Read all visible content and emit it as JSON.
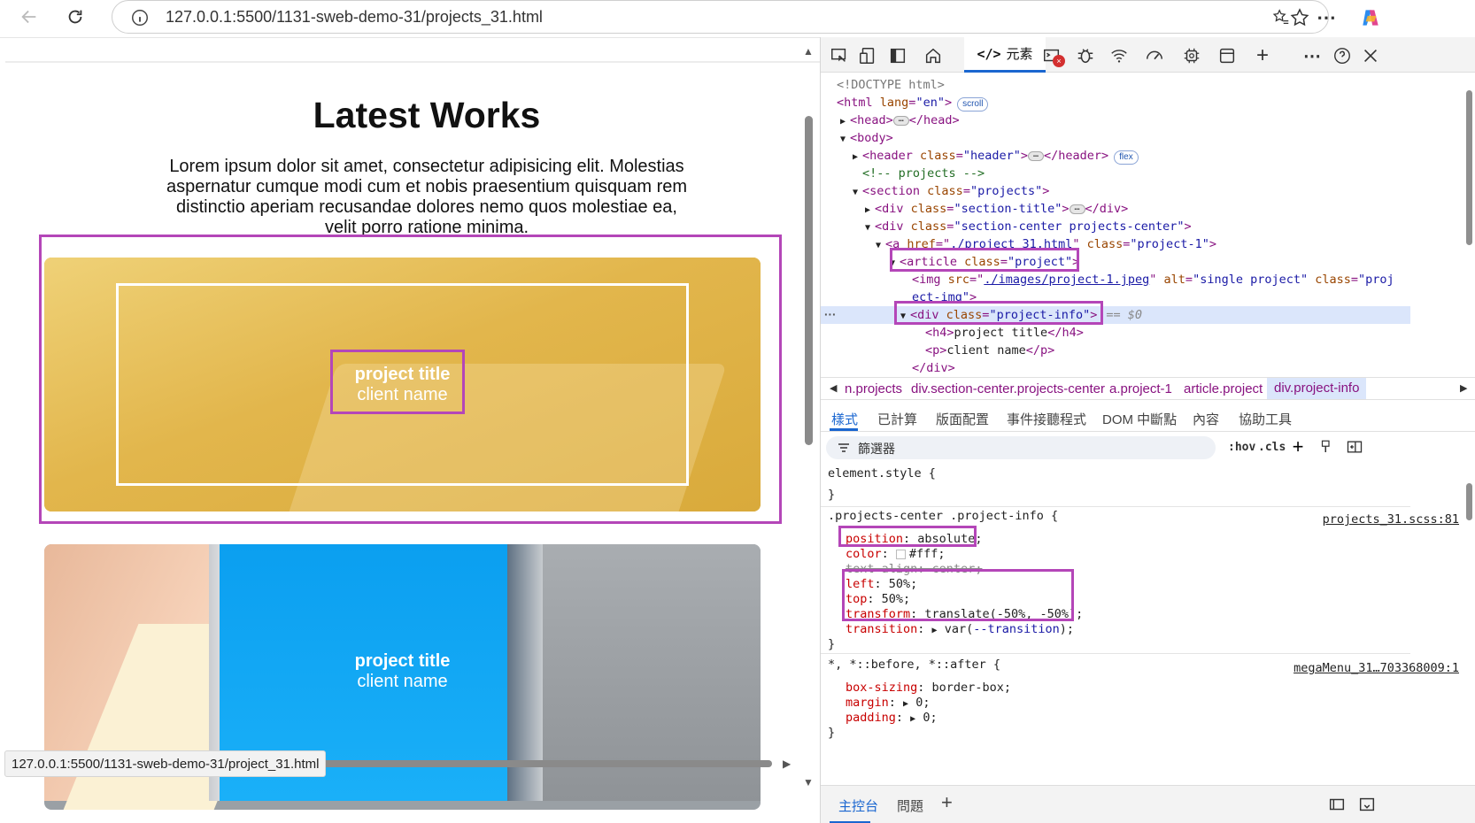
{
  "browser": {
    "url": "127.0.0.1:5500/1131-sweb-demo-31/projects_31.html",
    "status_url": "127.0.0.1:5500/1131-sweb-demo-31/project_31.html"
  },
  "page": {
    "title": "Latest Works",
    "description": "Lorem ipsum dolor sit amet, consectetur adipisicing elit. Molestias aspernatur cumque modi cum et nobis praesentium quisquam rem distinctio aperiam recusandae dolores nemo quos molestiae ea, velit porro ratione minima.",
    "projects": [
      {
        "title": "project title",
        "client": "client name"
      },
      {
        "title": "project title",
        "client": "client name"
      }
    ]
  },
  "devtools": {
    "elements_tab_label": "元素",
    "elements_tab_code": "</>",
    "dom": {
      "doctype": "<!DOCTYPE html>",
      "html_open": "<html",
      "html_attr": "lang",
      "html_val": "\"en\"",
      "html_badge": "scroll",
      "head": "<head>",
      "head_close": "</head>",
      "body": "<body>",
      "header_tag": "<header",
      "header_attr": "class",
      "header_val": "\"header\"",
      "header_close": "</header>",
      "header_badge": "flex",
      "comment": "<!-- projects -->",
      "section_tag": "<section",
      "section_attr": "class",
      "section_val": "\"projects\"",
      "div_title_tag": "<div",
      "div_title_attr": "class",
      "div_title_val": "\"section-title\"",
      "div_close": "</div>",
      "div_center_tag": "<div",
      "div_center_attr": "class",
      "div_center_val": "\"section-center projects-center\"",
      "a_tag": "<a",
      "a_href_attr": "href",
      "a_href_val": "./project_31.html",
      "a_class_attr": "class",
      "a_class_val": "\"project-1\"",
      "article_tag": "<article",
      "article_attr": "class",
      "article_val": "\"project\"",
      "img_tag": "<img",
      "img_src_attr": "src",
      "img_src_val": "./images/project-1.jpeg",
      "img_alt_attr": "alt",
      "img_alt_val": "\"single project\"",
      "img_class_attr": "class",
      "img_class_val_1": "\"proj",
      "img_class_val_2": "ect-img\"",
      "info_tag": "<div",
      "info_attr": "class",
      "info_val": "\"project-info\"",
      "info_marker": "== $0",
      "h4_open": "<h4>",
      "h4_text": "project title",
      "h4_close": "</h4>",
      "p_open": "<p>",
      "p_text": "client name",
      "p_close": "</p>",
      "div_end": "</div>"
    },
    "breadcrumbs": [
      "n.projects",
      "div.section-center.projects-center",
      "a.project-1",
      "article.project",
      "div.project-info"
    ],
    "subtabs": [
      "樣式",
      "已計算",
      "版面配置",
      "事件接聽程式",
      "DOM 中斷點",
      "內容",
      "協助工具"
    ],
    "filter_placeholder": "篩選器",
    "hov": ":hov",
    "cls": ".cls",
    "styles": {
      "element_style": "element.style {",
      "brace_close": "}",
      "rule1_selector": ".projects-center .project-info {",
      "rule1_source": "projects_31.scss:81",
      "rule1": [
        {
          "prop": "position",
          "val": "absolute;"
        },
        {
          "prop": "color",
          "val": "#fff;"
        },
        {
          "prop": "text-align",
          "val": "center;"
        },
        {
          "prop": "left",
          "val": "50%;"
        },
        {
          "prop": "top",
          "val": "50%;"
        },
        {
          "prop": "transform",
          "val": "translate(-50%, -50%);"
        },
        {
          "prop": "transition",
          "val": "var(",
          "var": "--transition",
          "val_end": ");"
        }
      ],
      "rule2_selector": "*, *::before, *::after {",
      "rule2_source": "megaMenu_31…703368009:1",
      "rule2": [
        {
          "prop": "box-sizing",
          "val": "border-box;"
        },
        {
          "prop": "margin",
          "val": "0;"
        },
        {
          "prop": "padding",
          "val": "0;"
        }
      ]
    },
    "drawer_tabs": [
      "主控台",
      "問題"
    ]
  },
  "colors": {
    "highlight": "#b446b8",
    "accent": "#1a66d0",
    "project1_tint": "#e0b449",
    "project2_screen": "#0b9ff0"
  }
}
